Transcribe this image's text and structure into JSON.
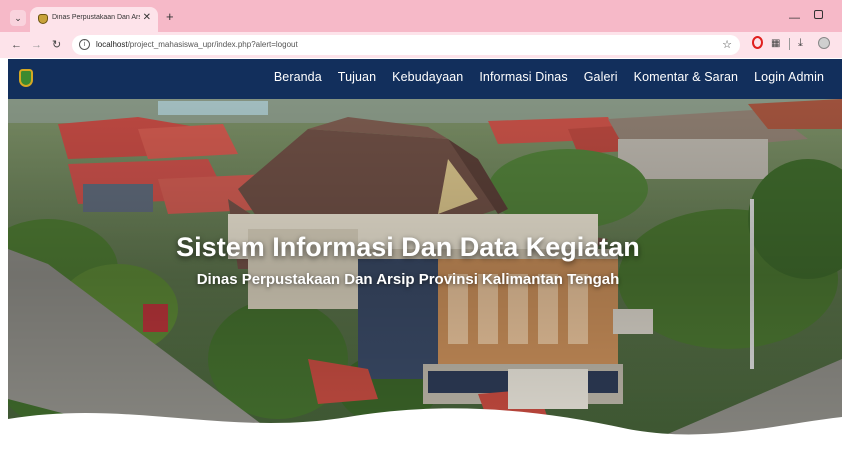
{
  "browser": {
    "tab": {
      "title": "Dinas Perpustakaan Dan Arsip Pr"
    },
    "address_bar": {
      "host": "localhost",
      "path": "/project_mahasiswa_upr/index.php?alert=logout"
    }
  },
  "site": {
    "nav": {
      "items": [
        {
          "label": "Beranda"
        },
        {
          "label": "Tujuan"
        },
        {
          "label": "Kebudayaan"
        },
        {
          "label": "Informasi Dinas"
        },
        {
          "label": "Galeri"
        },
        {
          "label": "Komentar & Saran"
        },
        {
          "label": "Login Admin"
        }
      ]
    },
    "hero": {
      "title": "Sistem Informasi Dan Data Kegiatan",
      "subtitle": "Dinas Perpustakaan Dan Arsip Provinsi Kalimantan Tengah"
    }
  },
  "icons": {
    "tab_menu": "chevron-down-icon",
    "favicon": "coat-of-arms-icon",
    "close": "close-icon",
    "new_tab": "plus-icon",
    "back": "arrow-left-icon",
    "forward": "arrow-right-icon",
    "reload": "reload-icon",
    "bookmark": "star-icon",
    "download": "download-icon"
  },
  "colors": {
    "tab_strip": "#f6b9c8",
    "toolbar": "#fde3ea",
    "navbar": "#122f5c",
    "nav_text": "#ffffff"
  }
}
